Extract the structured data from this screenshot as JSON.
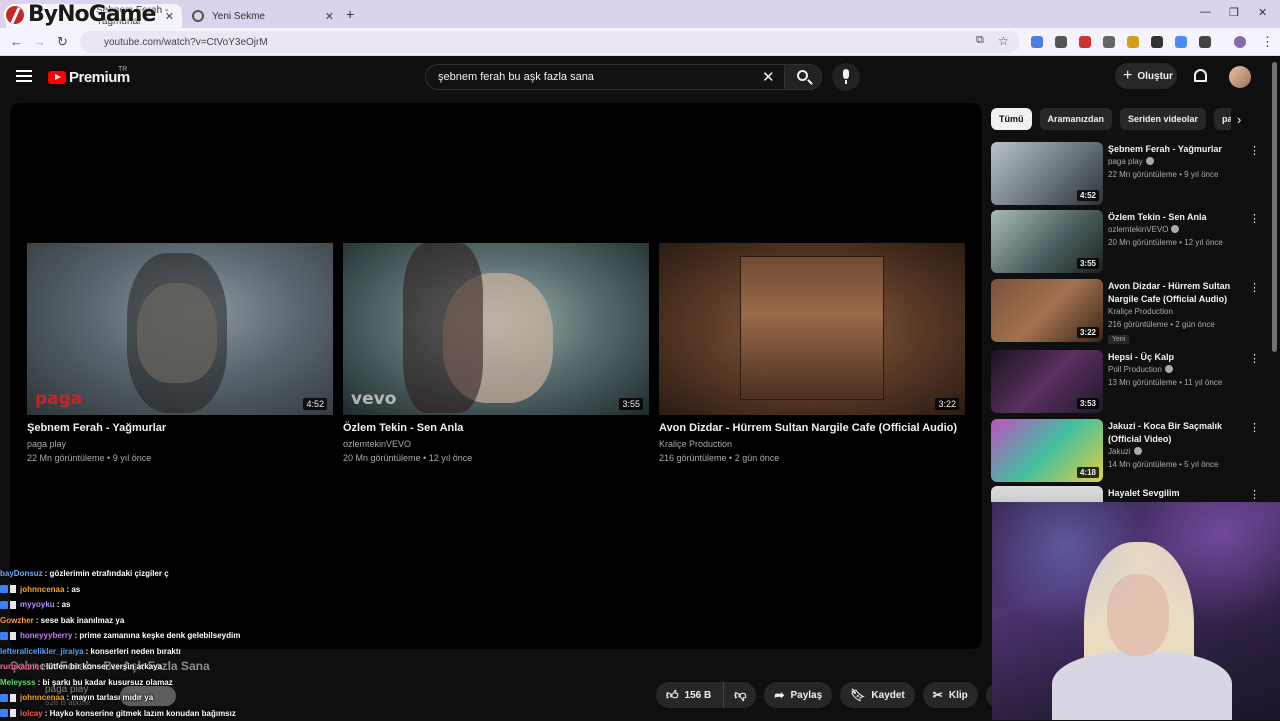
{
  "browser": {
    "tabs": [
      {
        "label": "Şebnem Ferah - Yağmurlar"
      },
      {
        "label": "Yeni Sekme"
      }
    ],
    "url": "youtube.com/watch?v=CtVoY3eOjrM",
    "overlay_logo": "ByNoGame"
  },
  "header": {
    "logo_text": "Premium",
    "region": "TR",
    "search_value": "şebnem ferah bu aşk fazla sana",
    "create_label": "Oluştur"
  },
  "endscreen": [
    {
      "title": "Şebnem Ferah - Yağmurlar",
      "channel": "paga play",
      "meta": "22 Mn görüntüleme • 9 yıl önce",
      "duration": "4:52",
      "watermark": "paga"
    },
    {
      "title": "Özlem Tekin - Sen Anla",
      "channel": "ozlemtekinVEVO",
      "meta": "20 Mn görüntüleme • 12 yıl önce",
      "duration": "3:55",
      "watermark": "vevo"
    },
    {
      "title": "Avon Dizdar - Hürrem Sultan Nargile Cafe (Official Audio)",
      "channel": "Kraliçe Production",
      "meta": "216 görüntüleme • 2 gün önce",
      "duration": "3:22"
    }
  ],
  "chat": [
    {
      "user": "bayDonsuz",
      "user_color": "#6fa8ff",
      "msg": ": gözlerimin etrafındaki çizgiler ç"
    },
    {
      "user": "johnncenaa",
      "user_color": "#f5a623",
      "msg": ": as",
      "badges": true
    },
    {
      "user": "myyoyku",
      "user_color": "#b98cff",
      "msg": ": as",
      "badges": true
    },
    {
      "user": "Gowzher",
      "user_color": "#ff9a3c",
      "msg": ": sese bak inanılmaz ya"
    },
    {
      "user": "honeyyyberry",
      "user_color": "#c77dff",
      "msg": ": prime zamanına keşke denk gelebilseydim",
      "badges": true
    },
    {
      "user": "lefteralicelikler_jiraiya",
      "user_color": "#4fa3ff",
      "msg": ": konserleri neden bıraktı"
    },
    {
      "user": "rurukanne",
      "user_color": "#ff6b9d",
      "msg": ": lütfen bir konser verşin arkaya"
    },
    {
      "user": "Meleysss",
      "user_color": "#5ee36b",
      "msg": ": bi şarkı bu kadar kusursuz olamaz"
    },
    {
      "user": "johnncenaa",
      "user_color": "#f5a623",
      "msg": ": mayın tarlası mıdır ya",
      "badges": true
    },
    {
      "user": "lolcay",
      "user_color": "#ff5a5a",
      "msg": ": Hayko konserine gitmek lazım konudan bağımsız",
      "badges": true
    }
  ],
  "ghost": {
    "title": "Şebnem Ferah - Bu Aşk Fazla Sana",
    "channel": "paga play",
    "subs": "526 B abone"
  },
  "actions": {
    "likes": "156 B",
    "share": "Paylaş",
    "save": "Kaydet",
    "clip": "Klip"
  },
  "chips": [
    "Tümü",
    "Aramanızdan",
    "Seriden videolar",
    "paga play"
  ],
  "recommendations": [
    {
      "title": "Şebnem Ferah - Yağmurlar",
      "channel": "paga play",
      "meta": "22 Mn görüntüleme • 9 yıl önce",
      "duration": "4:52",
      "verified": true
    },
    {
      "title": "Özlem Tekin - Sen Anla",
      "channel": "ozlemtekinVEVO",
      "meta": "20 Mn görüntüleme • 12 yıl önce",
      "duration": "3:55",
      "verified": true
    },
    {
      "title": "Avon Dizdar - Hürrem Sultan Nargile Cafe (Official Audio)",
      "channel": "Kraliçe Production",
      "meta": "216 görüntüleme • 2 gün önce",
      "duration": "3:22",
      "badge": "Yeni"
    },
    {
      "title": "Hepsi - Üç Kalp",
      "channel": "Poll Production",
      "meta": "13 Mn görüntüleme • 11 yıl önce",
      "duration": "3:53",
      "verified": true
    },
    {
      "title": "Jakuzi - Koca Bir Saçmalık (Official Video)",
      "channel": "Jakuzi",
      "meta": "14 Mn görüntüleme • 5 yıl önce",
      "duration": "4:18",
      "verified": true
    },
    {
      "title": "Hayalet Sevgilim"
    }
  ]
}
